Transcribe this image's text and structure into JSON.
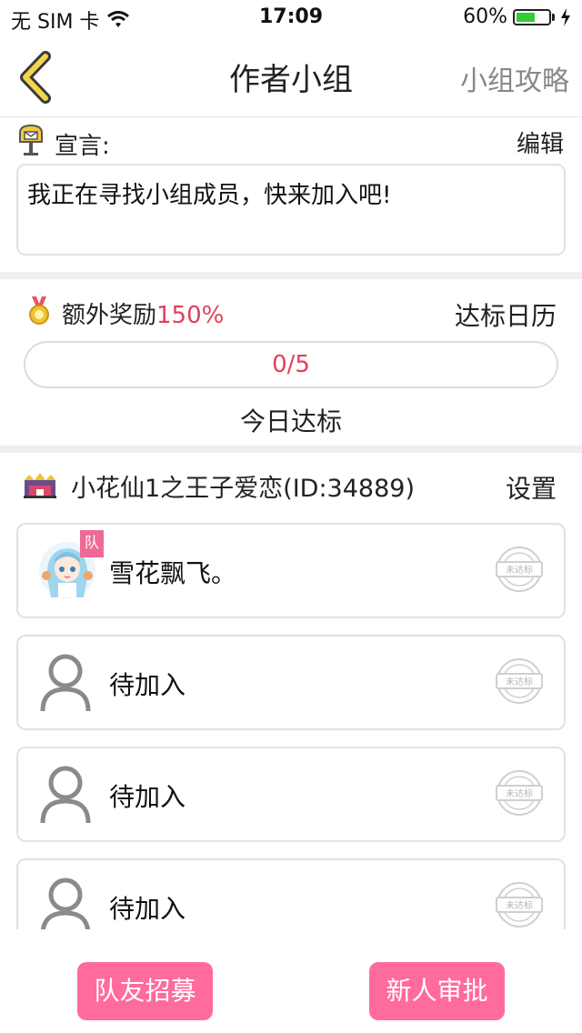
{
  "status_bar": {
    "carrier": "无 SIM 卡",
    "time": "17:09",
    "battery": "60%",
    "battery_level": 0.6
  },
  "nav": {
    "title": "作者小组",
    "right_link": "小组攻略"
  },
  "declaration": {
    "label": "宣言:",
    "edit": "编辑",
    "text": "我正在寻找小组成员，快来加入吧!"
  },
  "bonus": {
    "label": "额外奖励",
    "percent": "150%",
    "calendar": "达标日历"
  },
  "progress": {
    "text": "0/5",
    "fraction": 0.0,
    "caption": "今日达标"
  },
  "group": {
    "name": "小花仙1之王子爱恋(ID:34889)",
    "settings": "设置"
  },
  "members": [
    {
      "name": "雪花飘飞。",
      "badge": "队",
      "stamp": "未达标"
    },
    {
      "name": "待加入",
      "stamp": "未达标"
    },
    {
      "name": "待加入",
      "stamp": "未达标"
    },
    {
      "name": "待加入",
      "stamp": "未达标"
    }
  ],
  "actions": {
    "recruit": "队友招募",
    "approve": "新人审批"
  },
  "colors": {
    "accent": "#ff6b9a",
    "highlight": "#e0415b",
    "back_arrow": "#f2d64b"
  }
}
